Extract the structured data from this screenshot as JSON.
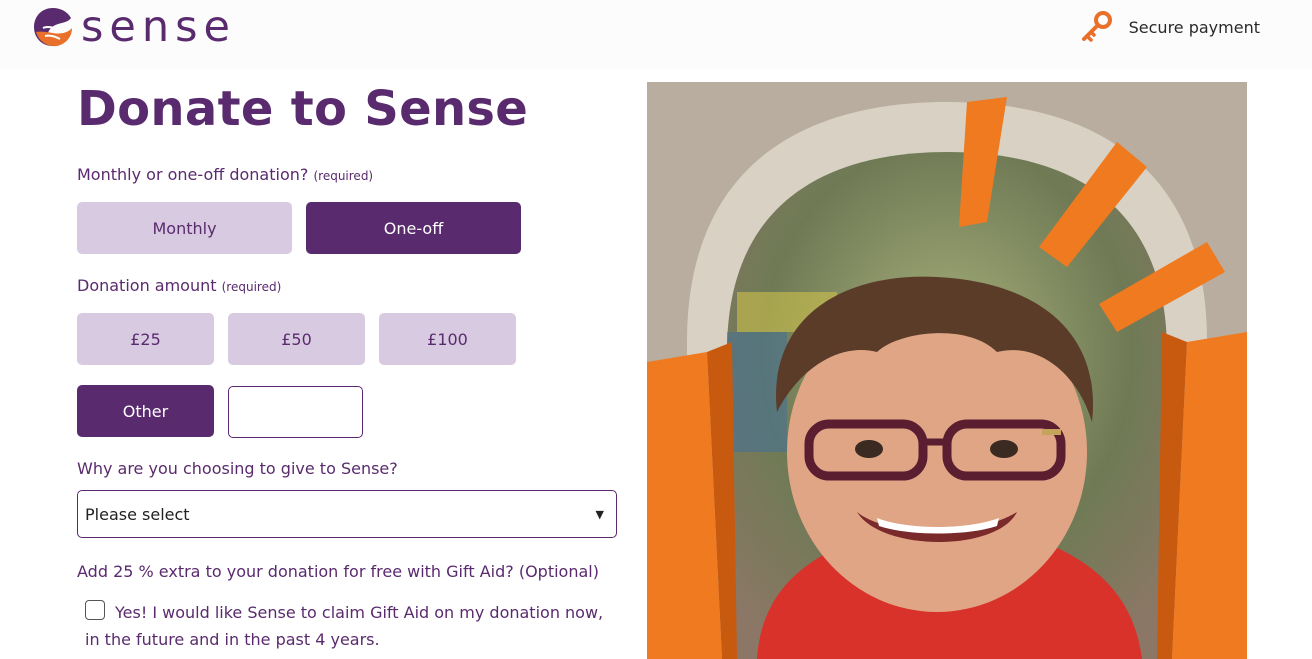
{
  "brand": {
    "name": "sense"
  },
  "header": {
    "secure_label": "Secure payment"
  },
  "page": {
    "title": "Donate to Sense"
  },
  "frequency": {
    "question": "Monthly or one-off donation?",
    "required": "(required)",
    "options": [
      {
        "label": "Monthly",
        "selected": false
      },
      {
        "label": "One-off",
        "selected": true
      }
    ]
  },
  "amount": {
    "question": "Donation amount",
    "required": "(required)",
    "options": [
      {
        "label": "£25",
        "selected": false
      },
      {
        "label": "£50",
        "selected": false
      },
      {
        "label": "£100",
        "selected": false
      },
      {
        "label": "Other",
        "selected": true
      }
    ],
    "other_value": ""
  },
  "reason": {
    "question": "Why are you choosing to give to Sense?",
    "selected": "Please select"
  },
  "gift_aid": {
    "question": "Add 25 % extra to your donation for free with Gift Aid? (Optional)",
    "checkbox_label": "Yes! I would like Sense to claim Gift Aid on my donation now, in the future and in the past 4 years.",
    "checked": false
  },
  "colors": {
    "brand_purple": "#5a2a6e",
    "light_purple": "#d8cae0",
    "brand_orange": "#e8702a"
  },
  "icons": {
    "logo": "sense-logo-icon",
    "key": "key-icon",
    "dropdown": "chevron-down-icon"
  }
}
